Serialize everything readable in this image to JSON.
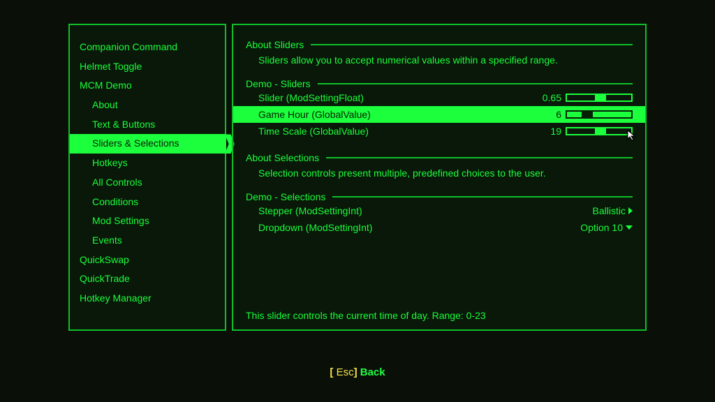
{
  "sidebar": {
    "items": [
      {
        "label": "Companion Command",
        "sub": false
      },
      {
        "label": "Helmet Toggle",
        "sub": false
      },
      {
        "label": "MCM Demo",
        "sub": false
      },
      {
        "label": "About",
        "sub": true
      },
      {
        "label": "Text & Buttons",
        "sub": true
      },
      {
        "label": "Sliders & Selections",
        "sub": true,
        "selected": true
      },
      {
        "label": "Hotkeys",
        "sub": true
      },
      {
        "label": "All Controls",
        "sub": true
      },
      {
        "label": "Conditions",
        "sub": true
      },
      {
        "label": "Mod Settings",
        "sub": true
      },
      {
        "label": "Events",
        "sub": true
      },
      {
        "label": "QuickSwap",
        "sub": false
      },
      {
        "label": "QuickTrade",
        "sub": false
      },
      {
        "label": "Hotkey Manager",
        "sub": false
      }
    ]
  },
  "sections": {
    "aboutSliders": {
      "title": "About Sliders",
      "desc": "Sliders allow you to accept numerical values within a specified range."
    },
    "demoSliders": {
      "title": "Demo - Sliders",
      "rows": [
        {
          "label": "Slider (ModSettingFloat)",
          "value": "0.65",
          "pos": 0.5
        },
        {
          "label": "Game Hour (GlobalValue)",
          "value": "6",
          "pos": 0.26,
          "highlight": true
        },
        {
          "label": "Time Scale (GlobalValue)",
          "value": "19",
          "pos": 0.5
        }
      ]
    },
    "aboutSelections": {
      "title": "About Selections",
      "desc": "Selection controls present multiple, predefined choices to the user."
    },
    "demoSelections": {
      "title": "Demo - Selections",
      "stepper": {
        "label": "Stepper (ModSettingInt)",
        "value": "Ballistic"
      },
      "dropdown": {
        "label": "Dropdown (ModSettingInt)",
        "value": "Option 10"
      }
    }
  },
  "footerDesc": "This slider controls the current time of day. Range: 0-23",
  "back": {
    "key": "Esc",
    "label": "Back"
  }
}
